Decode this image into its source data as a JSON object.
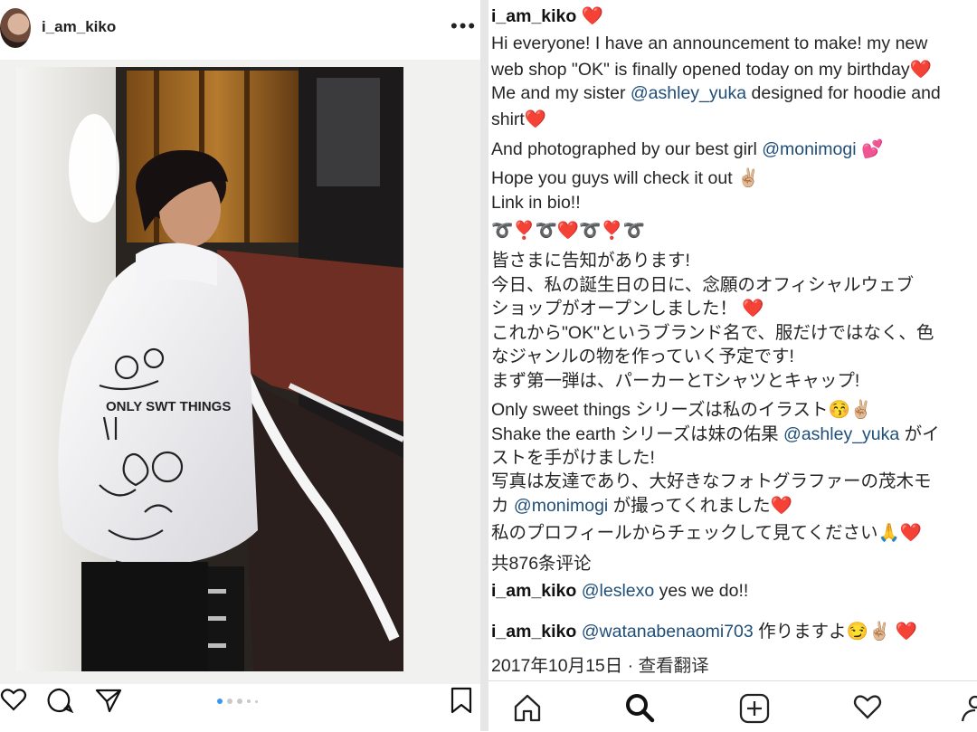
{
  "post": {
    "username": "i_am_kiko",
    "more_label": "•••"
  },
  "hoodie_text": "ONLY SWT THINGS",
  "caption": {
    "l1_user": "i_am_kiko",
    "l1_emoji": "❤️",
    "l2": "Hi everyone! I have an announcement to make! my new",
    "l3a": "web shop \"OK\" is finally opened today on my birthday",
    "l3_emoji": "❤️",
    "l4a": "Me and my sister ",
    "l4_mention": "@ashley_yuka",
    "l4b": " designed for hoodie and",
    "l5a": "shirt",
    "l5_emoji": "❤️",
    "l6a": "And photographed by our best girl ",
    "l6_mention": "@monimogi",
    "l6_emoji": " 💕",
    "l7a": "Hope you guys will check it out ",
    "l7_emoji": "✌🏼",
    "l8": "Link in bio!!",
    "l9": "➰❣️➰❤️➰❣️➰",
    "l10": "皆さまに告知があります!",
    "l11": "今日、私の誕生日の日に、念願のオフィシャルウェブ",
    "l12a": "ショップがオープンしました！ ",
    "l12_emoji": "❤️",
    "l13": "これから\"OK\"というブランド名で、服だけではなく、色",
    "l14": "なジャンルの物を作っていく予定です!",
    "l15": "まず第一弾は、パーカーとTシャツとキャップ!",
    "l16a": "Only sweet things シリーズは私のイラスト",
    "l16_emoji": "😚✌🏼",
    "l17a": "Shake the earth シリーズは妹の佑果 ",
    "l17_mention": "@ashley_yuka",
    "l17b": " がイ",
    "l18": "ストを手がけました!",
    "l19": "写真は友達であり、大好きなフォトグラファーの茂木モ",
    "l20a": "カ ",
    "l20_mention": "@monimogi",
    "l20b": " が撮ってくれました",
    "l20_emoji": "❤️",
    "l21a": "私のプロフィールからチェックして見てください",
    "l21_emoji": "🙏❤️"
  },
  "comments": {
    "count_label": "共876条评论",
    "c1_user": "i_am_kiko",
    "c1_mention": "@leslexo",
    "c1_text": " yes we do!!",
    "c2_user": "i_am_kiko",
    "c2_mention": "@watanabenaomi703",
    "c2_text": " 作りますよ",
    "c2_emoji": "😏✌🏼 ❤️"
  },
  "meta": {
    "date": "2017年10月15日",
    "sep": " · ",
    "translate": "查看翻译"
  },
  "icons": {
    "left_actions": [
      "heart-icon",
      "comment-icon",
      "share-icon",
      "bookmark-icon"
    ],
    "bottom_nav": [
      "home-icon",
      "search-icon",
      "add-icon",
      "activity-icon",
      "profile-icon"
    ]
  },
  "carousel": {
    "total": 5,
    "active": 1
  },
  "colors": {
    "mention": "#1f4e79",
    "heart": "#e0243c",
    "dot_active": "#3897f0",
    "divider": "#e6e6e6"
  }
}
